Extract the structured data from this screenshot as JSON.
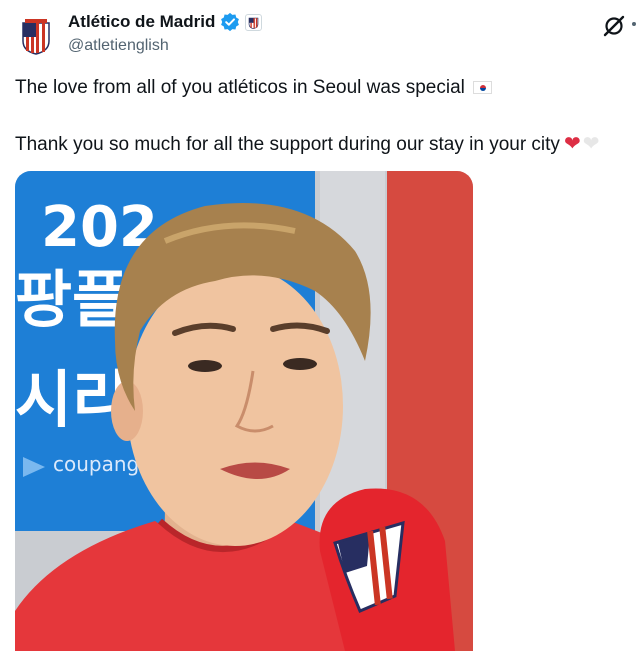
{
  "author": {
    "display_name": "Atlético de Madrid",
    "handle": "@atletienglish",
    "verified": true,
    "avatar_icon": "atletico-crest-icon",
    "affiliate_badge_icon": "atletico-crest-icon"
  },
  "tweet": {
    "line1": "The love from all of you atléticos in Seoul was special",
    "line1_emoji": "south-korea-flag",
    "line2": "Thank you so much for all the support during our stay in your city",
    "line2_emojis": [
      "red-heart",
      "white-heart"
    ]
  },
  "media": {
    "alt": "",
    "banner_text_top": "202",
    "banner_text_mid1": "팡플",
    "banner_text_mid2": "시리",
    "banner_logo_text": "coupang"
  },
  "colors": {
    "verified_blue": "#1d9bf0",
    "text_primary": "#0f1419",
    "text_secondary": "#536471",
    "heart_red": "#dd2e44",
    "banner_blue": "#1e7fd6",
    "shirt_red": "#e03a3a",
    "mic_red": "#e4252d"
  }
}
